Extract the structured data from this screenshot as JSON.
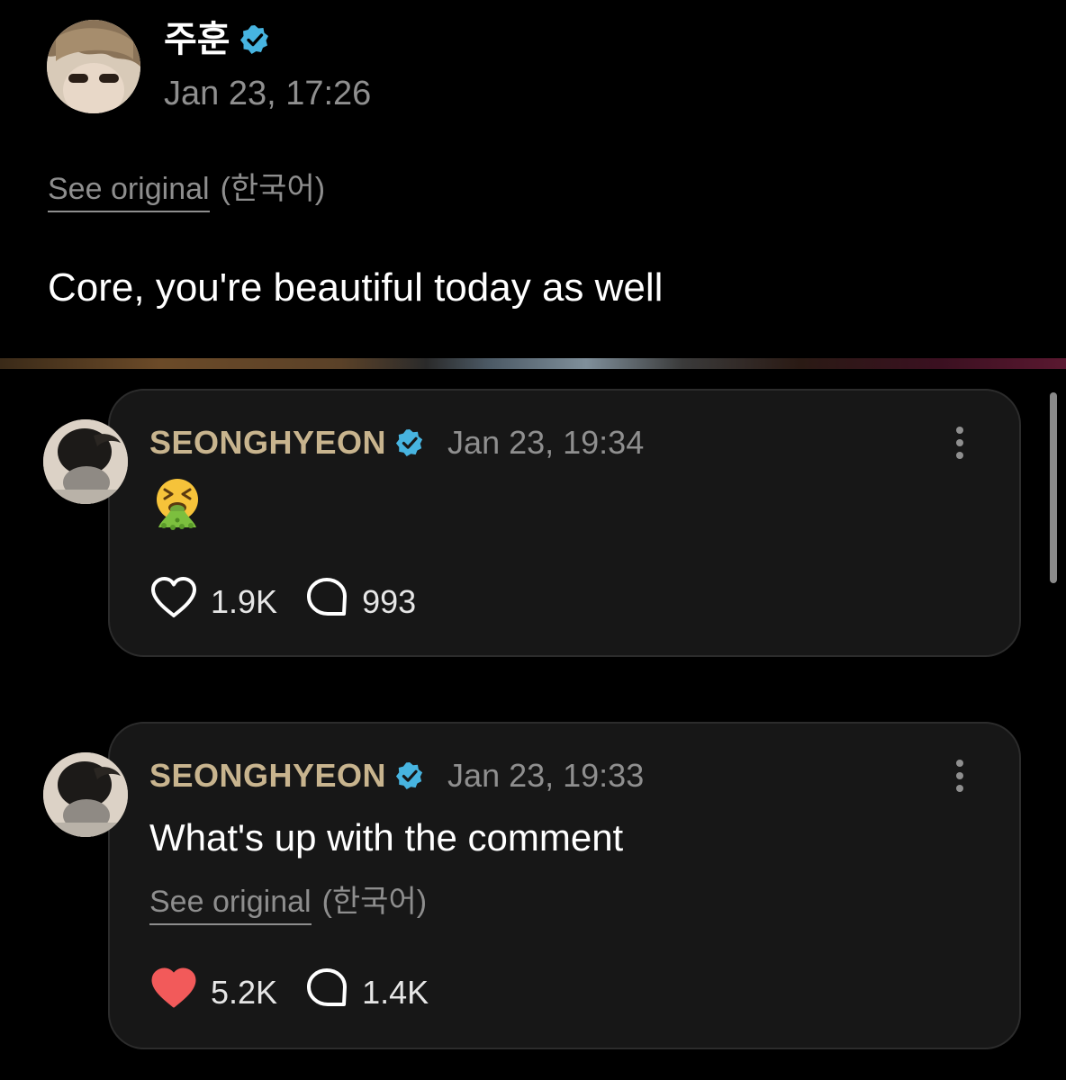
{
  "post": {
    "author": "주훈",
    "timestamp": "Jan 23, 17:26",
    "see_original": "See original",
    "language": "(한국어)",
    "text": "Core, you're beautiful today as well"
  },
  "comments": [
    {
      "author": "SEONGHYEON",
      "timestamp": "Jan 23, 19:34",
      "emoji": "vomiting-face",
      "likes": "1.9K",
      "liked": false,
      "replies": "993"
    },
    {
      "author": "SEONGHYEON",
      "timestamp": "Jan 23, 19:33",
      "text": "What's up with the comment",
      "see_original": "See original",
      "language": "(한국어)",
      "likes": "5.2K",
      "liked": true,
      "replies": "1.4K"
    }
  ],
  "colors": {
    "background": "#000000",
    "card_background": "#171717",
    "verified_badge": "#47b4e0",
    "comment_author": "#c8b48e",
    "liked_heart": "#f25a5a",
    "muted_text": "#8f8f8f"
  }
}
